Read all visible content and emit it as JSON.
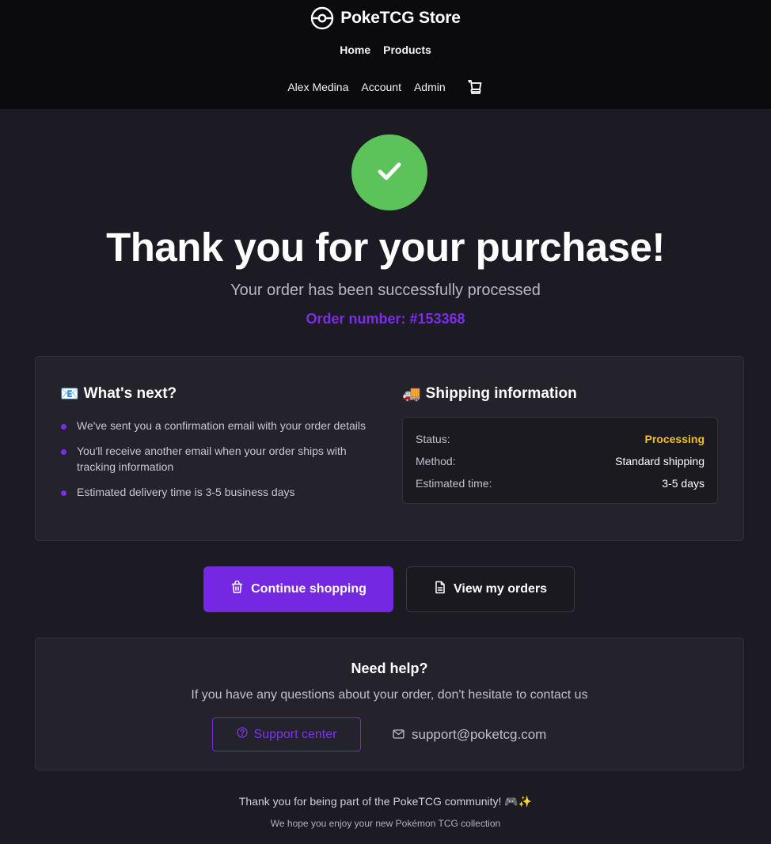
{
  "header": {
    "brand_name": "PokeTCG Store",
    "nav_primary": {
      "home": "Home",
      "products": "Products"
    },
    "nav_secondary": {
      "user": "Alex Medina",
      "account": "Account",
      "admin": "Admin"
    },
    "cart_icon": "cart-icon",
    "brand_icon": "pokeball-icon"
  },
  "hero": {
    "icon": "checkmark-icon",
    "title": "Thank you for your purchase!",
    "subtitle": "Your order has been successfully processed",
    "order_number": "Order number: #153368"
  },
  "next_steps": {
    "emoji": "📧",
    "heading": "What's next?",
    "items": [
      "We've sent you a confirmation email with your order details",
      "You'll receive another email when your order ships with tracking information",
      "Estimated delivery time is 3-5 business days"
    ]
  },
  "shipping": {
    "emoji": "🚚",
    "heading": "Shipping information",
    "rows": [
      {
        "label": "Status:",
        "value": "Processing"
      },
      {
        "label": "Method:",
        "value": "Standard shipping"
      },
      {
        "label": "Estimated time:",
        "value": "3-5 days"
      }
    ]
  },
  "actions": {
    "continue_label": "Continue shopping",
    "orders_label": "View my orders"
  },
  "help": {
    "title": "Need help?",
    "text": "If you have any questions about your order, don't hesitate to contact us",
    "support_label": "Support center",
    "email": "support@poketcg.com"
  },
  "footer": {
    "line1": "Thank you for being part of the PokeTCG community! 🎮✨",
    "line2": "We hope you enjoy your new Pokémon TCG collection"
  },
  "colors": {
    "accent": "#7428e2",
    "success": "#5cc35b",
    "status_processing": "#f5c11a",
    "background": "#1c1a22",
    "header_background": "#0b0a0d"
  }
}
